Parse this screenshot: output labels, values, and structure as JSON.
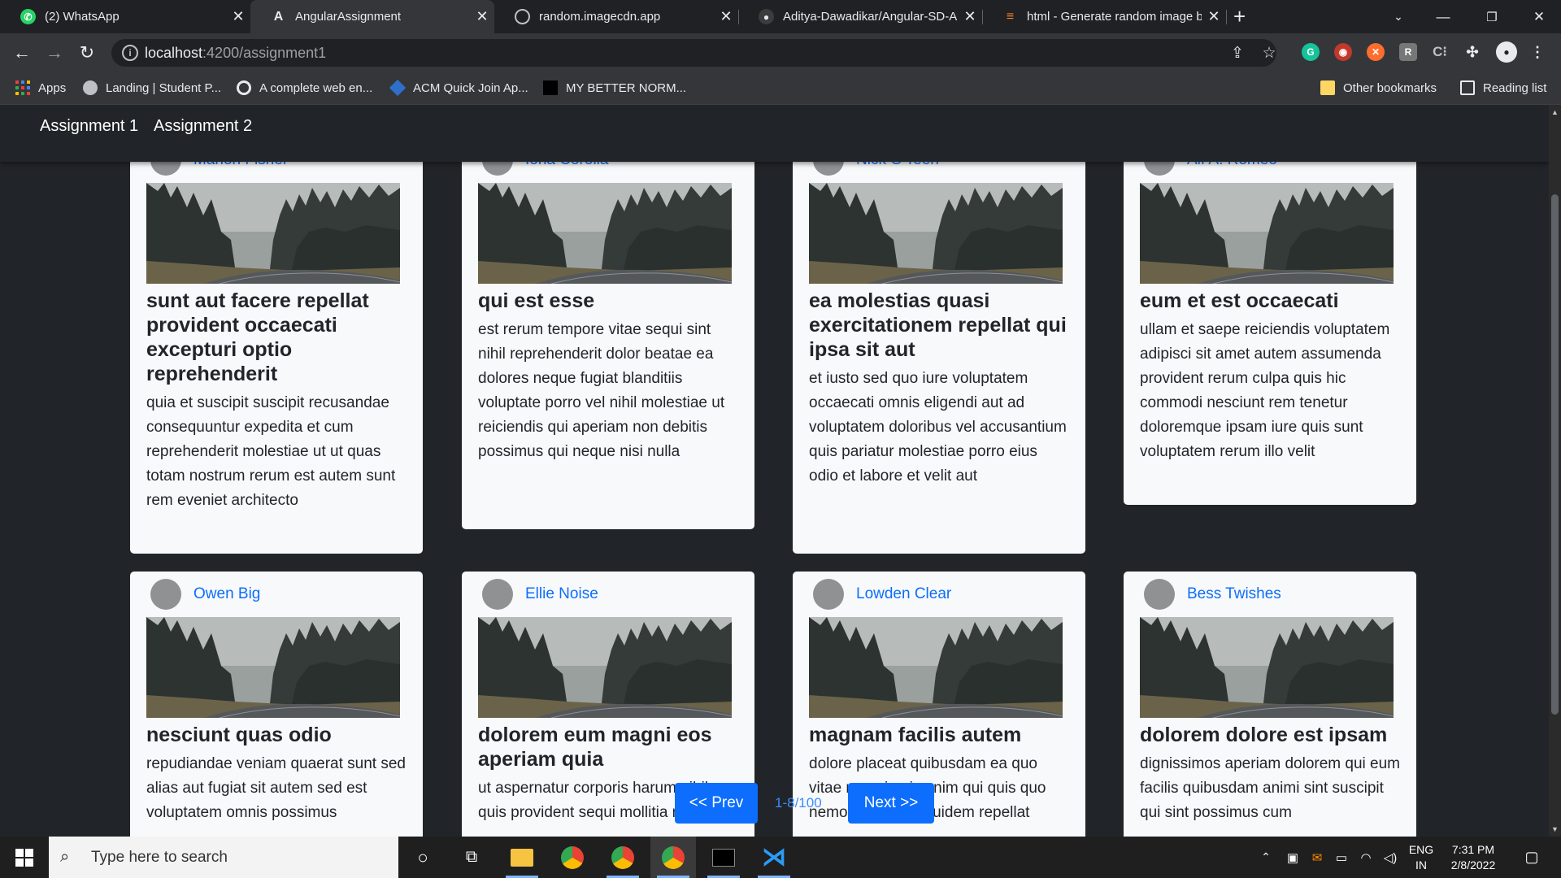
{
  "browser": {
    "tabs": [
      {
        "title": "(2) WhatsApp",
        "icon": "whatsapp-icon",
        "active": false
      },
      {
        "title": "AngularAssignment",
        "icon": "angular-icon",
        "active": true
      },
      {
        "title": "random.imagecdn.app",
        "icon": "globe-icon",
        "active": false
      },
      {
        "title": "Aditya-Dawadikar/Angular-SD-A",
        "icon": "github-icon",
        "active": false
      },
      {
        "title": "html - Generate random image b",
        "icon": "stackoverflow-icon",
        "active": false
      }
    ],
    "url_host": "localhost",
    "url_path": ":4200/assignment1",
    "bookmarks": [
      "Apps",
      "Landing | Student P...",
      "A complete web en...",
      "ACM Quick Join Ap...",
      "MY BETTER NORM..."
    ],
    "other_bookmarks": "Other bookmarks",
    "reading_list": "Reading list"
  },
  "app_nav": {
    "links": [
      "Assignment 1",
      "Assignment 2"
    ]
  },
  "posts": [
    {
      "author": "Marlon Fisher",
      "title": "sunt aut facere repellat provident occaecati excepturi optio reprehenderit",
      "body": "quia et suscipit suscipit recusandae consequuntur expedita et cum reprehenderit molestiae ut ut quas totam nostrum rerum est autem sunt rem eveniet architecto"
    },
    {
      "author": "Iona Corolla",
      "title": "qui est esse",
      "body": "est rerum tempore vitae sequi sint nihil reprehenderit dolor beatae ea dolores neque fugiat blanditiis voluptate porro vel nihil molestiae ut reiciendis qui aperiam non debitis possimus qui neque nisi nulla"
    },
    {
      "author": "Nick O'Teen",
      "title": "ea molestias quasi exercitationem repellat qui ipsa sit aut",
      "body": "et iusto sed quo iure voluptatem occaecati omnis eligendi aut ad voluptatem doloribus vel accusantium quis pariatur molestiae porro eius odio et labore et velit aut"
    },
    {
      "author": "Alf A. Romeo",
      "title": "eum et est occaecati",
      "body": "ullam et saepe reiciendis voluptatem adipisci sit amet autem assumenda provident rerum culpa quis hic commodi nesciunt rem tenetur doloremque ipsam iure quis sunt voluptatem rerum illo velit"
    },
    {
      "author": "Owen Big",
      "title": "nesciunt quas odio",
      "body": "repudiandae veniam quaerat sunt sed alias aut fugiat sit autem sed est voluptatem omnis possimus"
    },
    {
      "author": "Ellie Noise",
      "title": "dolorem eum magni eos aperiam quia",
      "body": "ut aspernatur corporis harum nihil quis provident sequi mollitia nobis"
    },
    {
      "author": "Lowden Clear",
      "title": "magnam facilis autem",
      "body": "dolore placeat quibusdam ea quo vitae magni quis enim qui quis quo nemo aut saepe quidem repellat"
    },
    {
      "author": "Bess Twishes",
      "title": "dolorem dolore est ipsam",
      "body": "dignissimos aperiam dolorem qui eum facilis quibusdam animi sint suscipit qui sint possimus cum"
    }
  ],
  "pagination": {
    "prev_label": "<< Prev",
    "next_label": "Next >>",
    "info": "1-8/100"
  },
  "taskbar": {
    "search_placeholder": "Type here to search",
    "lang_top": "ENG",
    "lang_bottom": "IN",
    "time": "7:31 PM",
    "date": "2/8/2022"
  },
  "colors": {
    "page_bg": "#212529",
    "card_bg": "#f8f9fa",
    "link": "#0d6efd",
    "button": "#0d6efd",
    "chrome_dark": "#202124",
    "chrome_toolbar": "#35363a"
  }
}
